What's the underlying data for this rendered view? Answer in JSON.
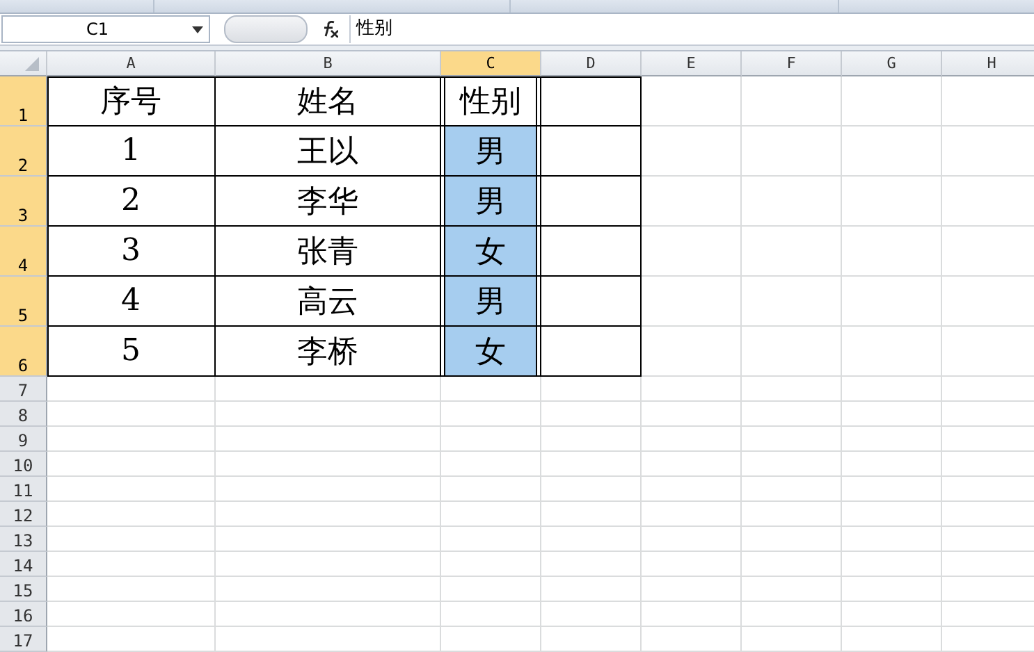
{
  "name_box": {
    "value": "C1"
  },
  "formula_bar": {
    "value": "性别"
  },
  "columns": [
    {
      "label": "A",
      "selected": false
    },
    {
      "label": "B",
      "selected": false
    },
    {
      "label": "C",
      "selected": true
    },
    {
      "label": "D",
      "selected": false
    },
    {
      "label": "E",
      "selected": false
    },
    {
      "label": "F",
      "selected": false
    },
    {
      "label": "G",
      "selected": false
    },
    {
      "label": "H",
      "selected": false
    }
  ],
  "rows": [
    {
      "label": "1",
      "selected": true,
      "bordered": true,
      "cells": [
        {
          "text": "序号",
          "selected": false
        },
        {
          "text": "姓名",
          "selected": false
        },
        {
          "text": "性别",
          "selected": false
        }
      ]
    },
    {
      "label": "2",
      "selected": true,
      "bordered": true,
      "cells": [
        {
          "text": "1",
          "selected": false
        },
        {
          "text": "王以",
          "selected": false
        },
        {
          "text": "男",
          "selected": true
        }
      ]
    },
    {
      "label": "3",
      "selected": true,
      "bordered": true,
      "cells": [
        {
          "text": "2",
          "selected": false
        },
        {
          "text": "李华",
          "selected": false
        },
        {
          "text": "男",
          "selected": true
        }
      ]
    },
    {
      "label": "4",
      "selected": true,
      "bordered": true,
      "cells": [
        {
          "text": "3",
          "selected": false
        },
        {
          "text": "张青",
          "selected": false
        },
        {
          "text": "女",
          "selected": true
        }
      ]
    },
    {
      "label": "5",
      "selected": true,
      "bordered": true,
      "cells": [
        {
          "text": "4",
          "selected": false
        },
        {
          "text": "高云",
          "selected": false
        },
        {
          "text": "男",
          "selected": true
        }
      ]
    },
    {
      "label": "6",
      "selected": true,
      "bordered": true,
      "cells": [
        {
          "text": "5",
          "selected": false
        },
        {
          "text": "李桥",
          "selected": false
        },
        {
          "text": "女",
          "selected": true
        }
      ]
    },
    {
      "label": "7",
      "selected": false,
      "bordered": false,
      "cells": []
    },
    {
      "label": "8",
      "selected": false,
      "bordered": false,
      "cells": []
    },
    {
      "label": "9",
      "selected": false,
      "bordered": false,
      "cells": []
    },
    {
      "label": "10",
      "selected": false,
      "bordered": false,
      "cells": []
    },
    {
      "label": "11",
      "selected": false,
      "bordered": false,
      "cells": []
    },
    {
      "label": "12",
      "selected": false,
      "bordered": false,
      "cells": []
    },
    {
      "label": "13",
      "selected": false,
      "bordered": false,
      "cells": []
    },
    {
      "label": "14",
      "selected": false,
      "bordered": false,
      "cells": []
    },
    {
      "label": "15",
      "selected": false,
      "bordered": false,
      "cells": []
    },
    {
      "label": "16",
      "selected": false,
      "bordered": false,
      "cells": []
    },
    {
      "label": "17",
      "selected": false,
      "bordered": false,
      "cells": []
    }
  ]
}
